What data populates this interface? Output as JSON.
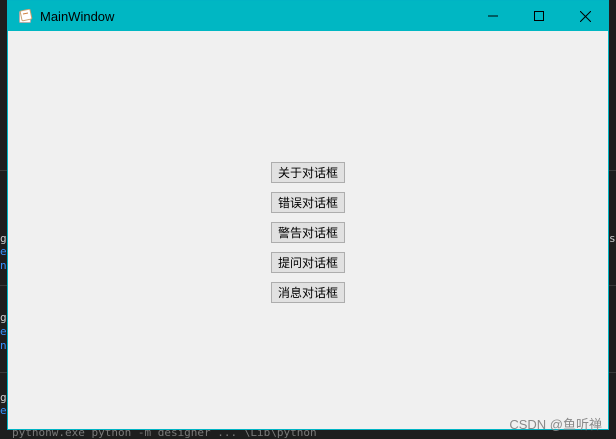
{
  "window": {
    "title": "MainWindow"
  },
  "buttons": [
    {
      "label": "关于对话框"
    },
    {
      "label": "错误对话框"
    },
    {
      "label": "警告对话框"
    },
    {
      "label": "提问对话框"
    },
    {
      "label": "消息对话框"
    }
  ],
  "background": {
    "fragments": [
      "g",
      "e",
      "n",
      "g",
      "e",
      "n",
      "g",
      "e",
      "sc"
    ],
    "bottom_text": "pythonw.exe python -m designer ... \\Lib\\python"
  },
  "watermark": "CSDN @鱼听禅",
  "colors": {
    "titlebar": "#00b7c3",
    "window_bg": "#f0f0f0",
    "button_bg": "#e1e1e1"
  }
}
